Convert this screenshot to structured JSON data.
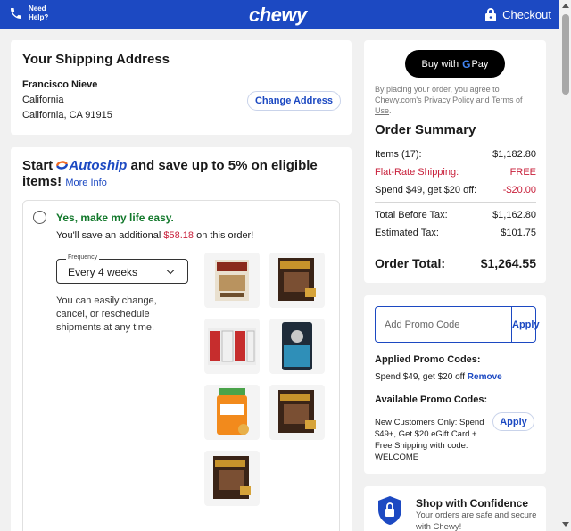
{
  "header": {
    "help_line1": "Need",
    "help_line2": "Help?",
    "logo": "chewy",
    "checkout_label": "Checkout",
    "bg_color": "#1c49c2"
  },
  "shipping": {
    "title": "Your Shipping Address",
    "name": "Francisco Nieve",
    "line1": "California",
    "line2": "California, CA 91915",
    "change_label": "Change Address"
  },
  "autoship": {
    "headline_start": "Start",
    "brand": "Autoship",
    "headline_end": "and save up to 5% on eligible items!",
    "more_info": "More Info",
    "option_title": "Yes, make my life easy.",
    "save_prefix": "You'll save an additional",
    "save_amount": "$58.18",
    "save_suffix": "on this order!",
    "frequency_label": "Frequency",
    "frequency_value": "Every 4 weeks",
    "note": "You can easily change, cancel, or reschedule shipments at any time.",
    "products": [
      {
        "name": "treats-box"
      },
      {
        "name": "heartgard-box"
      },
      {
        "name": "cans-pack"
      },
      {
        "name": "dog-food-bag"
      },
      {
        "name": "supplement-tub"
      },
      {
        "name": "heartgard-box-2"
      },
      {
        "name": "heartgard-box-3"
      }
    ]
  },
  "payment": {
    "gpay_label": "Buy with",
    "gpay_brand": "Pay",
    "legal_prefix": "By placing your order, you agree to Chewy.com's",
    "privacy": "Privacy Policy",
    "and": "and",
    "terms": "Terms of Use",
    "legal_end": "."
  },
  "summary": {
    "title": "Order Summary",
    "items_label": "Items (17):",
    "items_value": "$1,182.80",
    "shipping_label": "Flat-Rate Shipping:",
    "shipping_value": "FREE",
    "promo_label": "Spend $49, get $20 off:",
    "promo_value": "-$20.00",
    "before_tax_label": "Total Before Tax:",
    "before_tax_value": "$1,162.80",
    "tax_label": "Estimated Tax:",
    "tax_value": "$101.75",
    "total_label": "Order Total:",
    "total_value": "$1,264.55"
  },
  "promo": {
    "placeholder": "Add Promo Code",
    "apply_label": "Apply",
    "applied_title": "Applied Promo Codes:",
    "applied_code": "Spend $49, get $20 off",
    "remove_label": "Remove",
    "available_title": "Available Promo Codes:",
    "available_text": "New Customers Only: Spend $49+, Get $20 eGift Card + Free Shipping with code: WELCOME",
    "available_apply": "Apply"
  },
  "confidence": {
    "title": "Shop with Confidence",
    "subtitle": "Your orders are safe and secure with Chewy!"
  }
}
